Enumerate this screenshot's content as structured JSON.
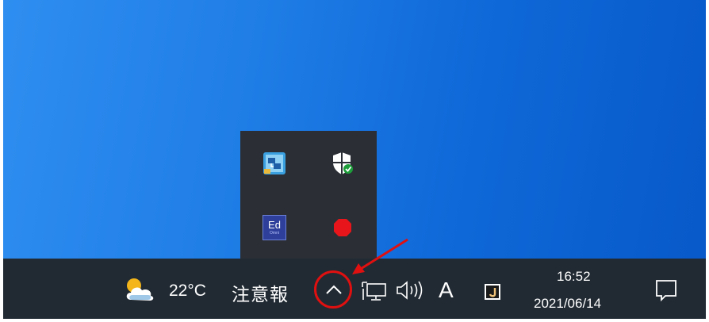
{
  "overflow_tray": {
    "icons": [
      "network-map-app-icon",
      "windows-security-icon",
      "ed-app-icon",
      "red-stop-icon"
    ],
    "ed_label": "Ed",
    "ed_sub": "Omni"
  },
  "taskbar": {
    "weather": {
      "icon": "cloud-sun-icon",
      "temperature": "22°C",
      "alert": "注意報"
    },
    "show_hidden_icon": "chevron-up-icon",
    "network_icon": "network-monitor-icon",
    "volume_icon": "speaker-icon",
    "ime_mode": "A",
    "app_icon": "j-app-icon",
    "clock": {
      "time": "16:52",
      "date": "2021/06/14"
    },
    "notification_icon": "action-center-icon"
  },
  "annotation": {
    "highlight_color": "#e01010"
  },
  "colors": {
    "taskbar_bg": "#212a33",
    "tray_bg": "#2b2f35",
    "desktop": "#1f7de6"
  }
}
